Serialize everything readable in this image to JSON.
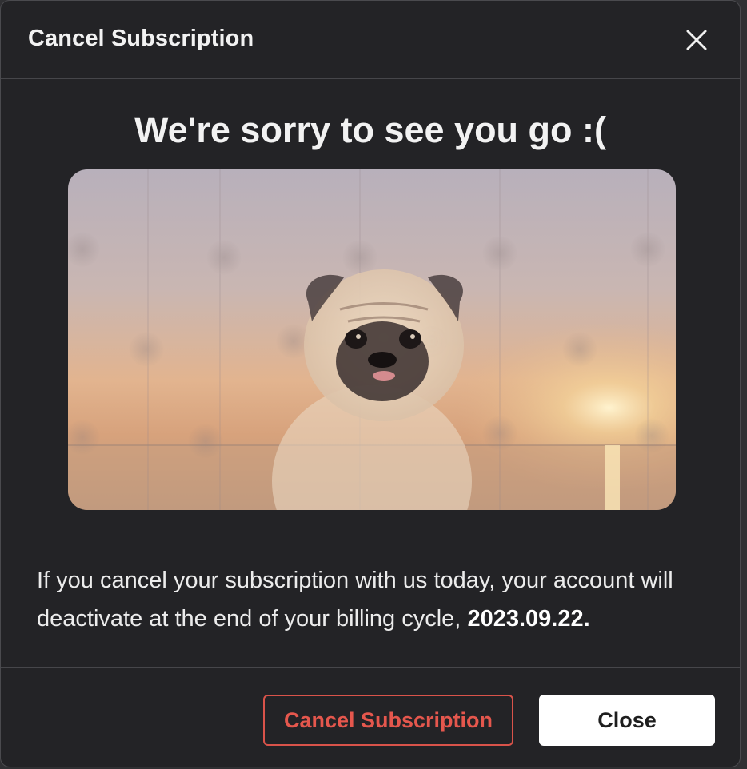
{
  "modal": {
    "title": "Cancel Subscription",
    "close_icon": "close-icon"
  },
  "body": {
    "headline": "We're sorry to see you go :(",
    "image_alt": "sad pug dog over sunset sea",
    "message_text": "If you cancel your subscription with us today, your account will deactivate at the end of your billing cycle, ",
    "deactivation_date": "2023.09.22",
    "trailing_period": "."
  },
  "footer": {
    "cancel_label": "Cancel Subscription",
    "close_label": "Close"
  },
  "colors": {
    "modal_bg": "#232326",
    "danger": "#e5574d",
    "primary_button_bg": "#ffffff"
  }
}
